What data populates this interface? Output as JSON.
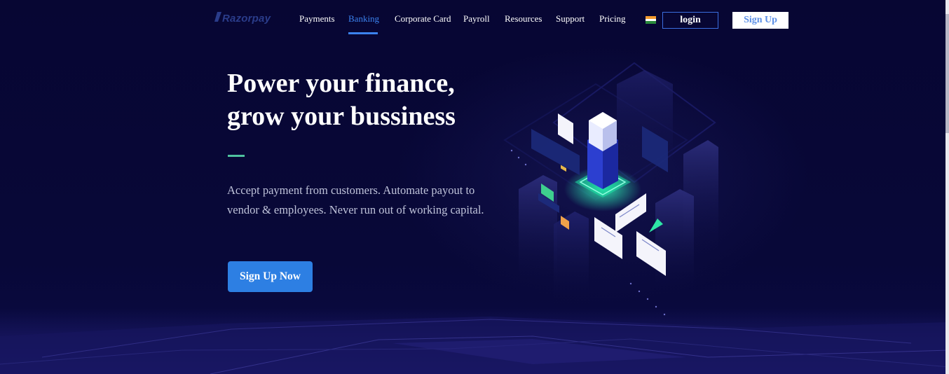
{
  "brand": {
    "name": "Razorpay",
    "logo_icon": "razorpay-slash-icon",
    "color": "#2a3c8a"
  },
  "nav": {
    "items": [
      {
        "label": "Payments",
        "active": false
      },
      {
        "label": "Banking",
        "active": true
      },
      {
        "label": "Corporate Card",
        "active": false
      },
      {
        "label": "Payroll",
        "active": false
      },
      {
        "label": "Resources",
        "active": false
      },
      {
        "label": "Support",
        "active": false
      },
      {
        "label": "Pricing",
        "active": false
      }
    ],
    "flag_icon": "india-flag-icon",
    "login_label": "login",
    "signup_label": "Sign Up",
    "active_color": "#3b82ee"
  },
  "hero": {
    "title_line1": "Power your finance,",
    "title_line2": "grow your bussiness",
    "description": "Accept payment from customers. Automate payout to vendor & employees. Never run out of working capital.",
    "cta_label": "Sign Up Now",
    "cta_color": "#2d7fe3",
    "accent_color": "#4fc29f"
  },
  "illustration": {
    "icon": "isometric-banking-tower-illustration"
  },
  "colors": {
    "background": "#07063a",
    "text": "#ffffff",
    "muted_text": "#bfc3da"
  }
}
